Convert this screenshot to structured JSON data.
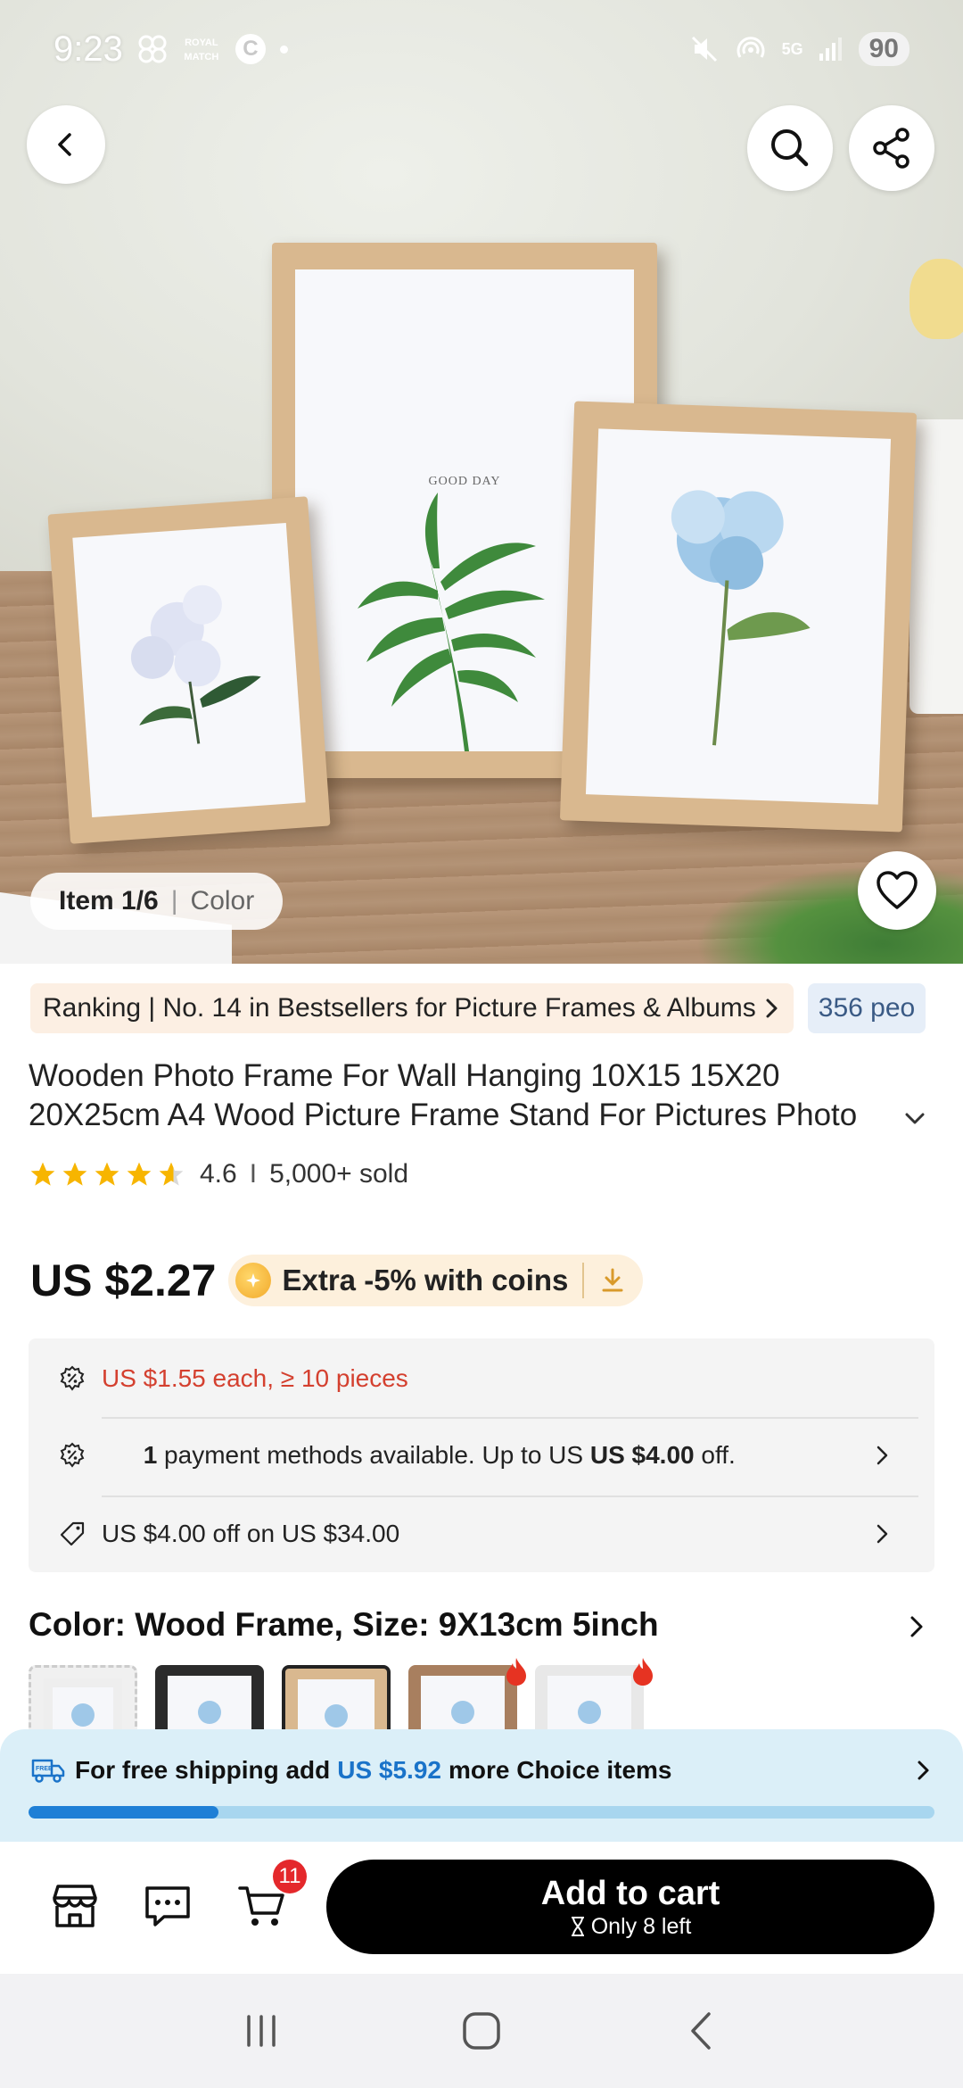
{
  "status_bar": {
    "time": "9:23",
    "notif_icons": [
      "pinwheel-icon",
      "royal-match-icon",
      "c-icon",
      "dot-icon"
    ],
    "royal_match_text": "ROYAL MATCH",
    "c_label": "C",
    "network": "5G",
    "battery": "90"
  },
  "gallery": {
    "item_count": "Item 1/6",
    "separator": "|",
    "item_label": "Color",
    "frame_caption": "GOOD DAY"
  },
  "ranking": {
    "text": "Ranking | No. 14 in Bestsellers  for Picture Frames & Albums",
    "people_text": "356 peo"
  },
  "product": {
    "title": "Wooden Photo Frame For Wall Hanging 10X15 15X20 20X25cm A4 Wood Picture Frame Stand For Pictures Photo",
    "rating": "4.6",
    "rating_separator": "I",
    "sold": "5,000+ sold",
    "price": "US $2.27",
    "coins_text": "Extra -5% with coins"
  },
  "promos": {
    "bulk": "US $1.55 each, ≥ 10 pieces",
    "payment_count": "1",
    "payment_mid": " payment methods available. Up to US ",
    "payment_amount": "US $4.00",
    "payment_end": " off.",
    "coupon": "US $4.00 off on US $34.00"
  },
  "variant": {
    "title": "Color: Wood Frame, Size: 9X13cm 5inch"
  },
  "shipping": {
    "prefix": "For free shipping add",
    "amount": "US $5.92",
    "suffix": "more Choice items",
    "progress": 0.21
  },
  "actions": {
    "cart_count": "11",
    "add_to_cart": "Add to cart",
    "stock": "Only 8 left"
  },
  "colors": {
    "accent_red": "#d4402f",
    "link_blue": "#1a73c9",
    "star_gold": "#f7b500",
    "badge_red": "#e4282b"
  }
}
